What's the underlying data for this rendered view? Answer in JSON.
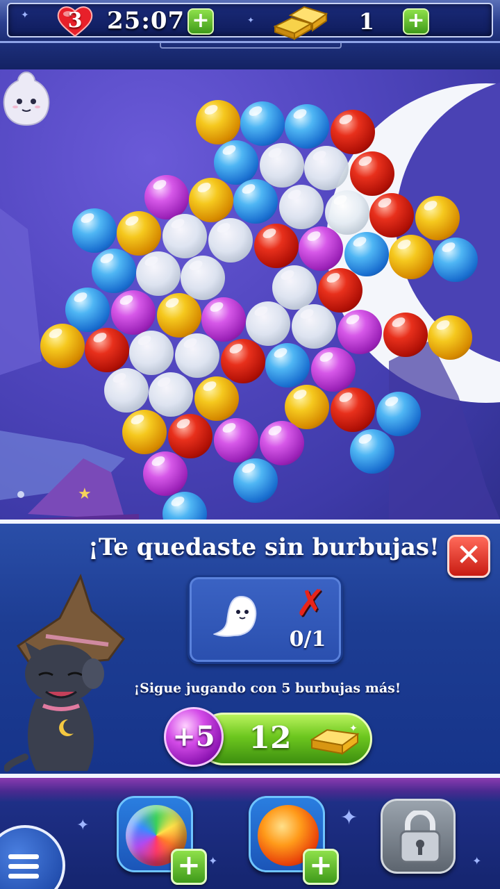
{
  "top_bar": {
    "lives": "3",
    "timer": "25:07",
    "gold_bars": "1"
  },
  "dialog": {
    "title": "¡Te quedaste sin burbujas!",
    "goal_count": "0/1",
    "subtitle": "¡Sigue jugando con 5 burbujas más!",
    "bonus_label": "+5",
    "price": "12"
  },
  "board": {
    "bubbles": [
      [
        "yellow",
        314,
        176
      ],
      [
        "blue",
        378,
        178
      ],
      [
        "blue",
        442,
        182
      ],
      [
        "red",
        508,
        190
      ],
      [
        "blue",
        340,
        234
      ],
      [
        "cloud",
        406,
        238
      ],
      [
        "cloud",
        470,
        242
      ],
      [
        "red",
        536,
        250
      ],
      [
        "purple",
        240,
        284
      ],
      [
        "yellow",
        304,
        288
      ],
      [
        "blue",
        368,
        290
      ],
      [
        "cloud",
        434,
        298
      ],
      [
        "cloud",
        500,
        306
      ],
      [
        "red",
        564,
        310
      ],
      [
        "yellow",
        630,
        314
      ],
      [
        "blue",
        136,
        332
      ],
      [
        "yellow",
        200,
        336
      ],
      [
        "cloud",
        266,
        340
      ],
      [
        "cloud",
        332,
        346
      ],
      [
        "red",
        398,
        354
      ],
      [
        "purple",
        462,
        358
      ],
      [
        "blue",
        528,
        366
      ],
      [
        "yellow",
        592,
        370
      ],
      [
        "blue",
        656,
        374
      ],
      [
        "blue",
        164,
        390
      ],
      [
        "cloud",
        228,
        394
      ],
      [
        "cloud",
        292,
        400
      ],
      [
        "cloud",
        424,
        414
      ],
      [
        "red",
        490,
        418
      ],
      [
        "blue",
        126,
        446
      ],
      [
        "purple",
        192,
        450
      ],
      [
        "yellow",
        258,
        454
      ],
      [
        "purple",
        322,
        460
      ],
      [
        "cloud",
        386,
        466
      ],
      [
        "cloud",
        452,
        470
      ],
      [
        "purple",
        518,
        478
      ],
      [
        "red",
        584,
        482
      ],
      [
        "yellow",
        648,
        486
      ],
      [
        "yellow",
        90,
        498
      ],
      [
        "red",
        154,
        504
      ],
      [
        "cloud",
        218,
        508
      ],
      [
        "cloud",
        284,
        512
      ],
      [
        "red",
        350,
        520
      ],
      [
        "blue",
        414,
        526
      ],
      [
        "purple",
        480,
        532
      ],
      [
        "cloud",
        182,
        562
      ],
      [
        "cloud",
        246,
        568
      ],
      [
        "yellow",
        312,
        574
      ],
      [
        "yellow",
        442,
        586
      ],
      [
        "red",
        508,
        590
      ],
      [
        "blue",
        574,
        596
      ],
      [
        "yellow",
        208,
        622
      ],
      [
        "red",
        274,
        628
      ],
      [
        "purple",
        340,
        634
      ],
      [
        "purple",
        406,
        638
      ],
      [
        "blue",
        536,
        650
      ],
      [
        "purple",
        238,
        682
      ],
      [
        "blue",
        368,
        692
      ],
      [
        "blue",
        266,
        740
      ]
    ]
  }
}
